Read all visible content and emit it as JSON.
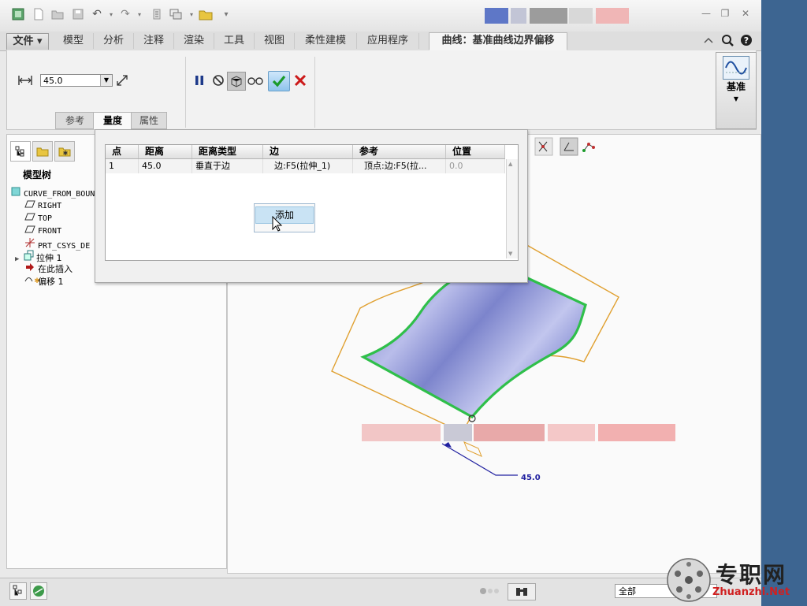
{
  "toolbar": {
    "icons": [
      "app-icon",
      "new-icon",
      "open-icon",
      "save-icon",
      "undo-icon",
      "redo-icon",
      "regenerate-icon",
      "windows-icon",
      "folder-icon",
      "customize-icon"
    ]
  },
  "tabs": [
    {
      "label": "文件 ▾"
    },
    {
      "label": "模型"
    },
    {
      "label": "分析"
    },
    {
      "label": "注释"
    },
    {
      "label": "渲染"
    },
    {
      "label": "工具"
    },
    {
      "label": "视图"
    },
    {
      "label": "柔性建模"
    },
    {
      "label": "应用程序"
    },
    {
      "label": "曲线：基准曲线边界偏移"
    }
  ],
  "ribbon": {
    "offset_value": "45.0",
    "group_label": "基准"
  },
  "subtabs": [
    {
      "label": "参考"
    },
    {
      "label": "量度"
    },
    {
      "label": "属性"
    }
  ],
  "measure_table": {
    "headers": [
      "点",
      "距离",
      "距离类型",
      "边",
      "参考",
      "位置"
    ],
    "rows": [
      [
        "1",
        "45.0",
        "垂直于边",
        "边:F5(拉伸_1)",
        "顶点:边:F5(拉...",
        "0.0"
      ]
    ]
  },
  "context_menu": {
    "item": "添加"
  },
  "model_tree": {
    "title": "模型树",
    "items": [
      {
        "label": "CURVE_FROM_BOUN",
        "icon": "part-icon"
      },
      {
        "label": "RIGHT",
        "icon": "datum-plane-icon"
      },
      {
        "label": "TOP",
        "icon": "datum-plane-icon"
      },
      {
        "label": "FRONT",
        "icon": "datum-plane-icon"
      },
      {
        "label": "PRT_CSYS_DE",
        "icon": "csys-icon"
      },
      {
        "label": "拉伸 1",
        "icon": "extrude-icon"
      },
      {
        "label": "在此插入",
        "icon": "insert-here-icon"
      },
      {
        "label": "偏移 1",
        "icon": "offset-curve-icon"
      }
    ]
  },
  "dimension": {
    "value": "45.0"
  },
  "status": {
    "filter": "全部"
  },
  "watermark": {
    "text": "专职网",
    "url_text": "Zhuanzhi.Net"
  },
  "colors": {
    "accent_blue": "#3d6591",
    "surface_fill": "#8c93d6",
    "edge_green": "#2fbf4a",
    "offset_curve": "#e0a030",
    "dimension_blue": "#2020a0",
    "ok_check": "#1a9a2a",
    "cancel_x": "#cc1a1a"
  }
}
